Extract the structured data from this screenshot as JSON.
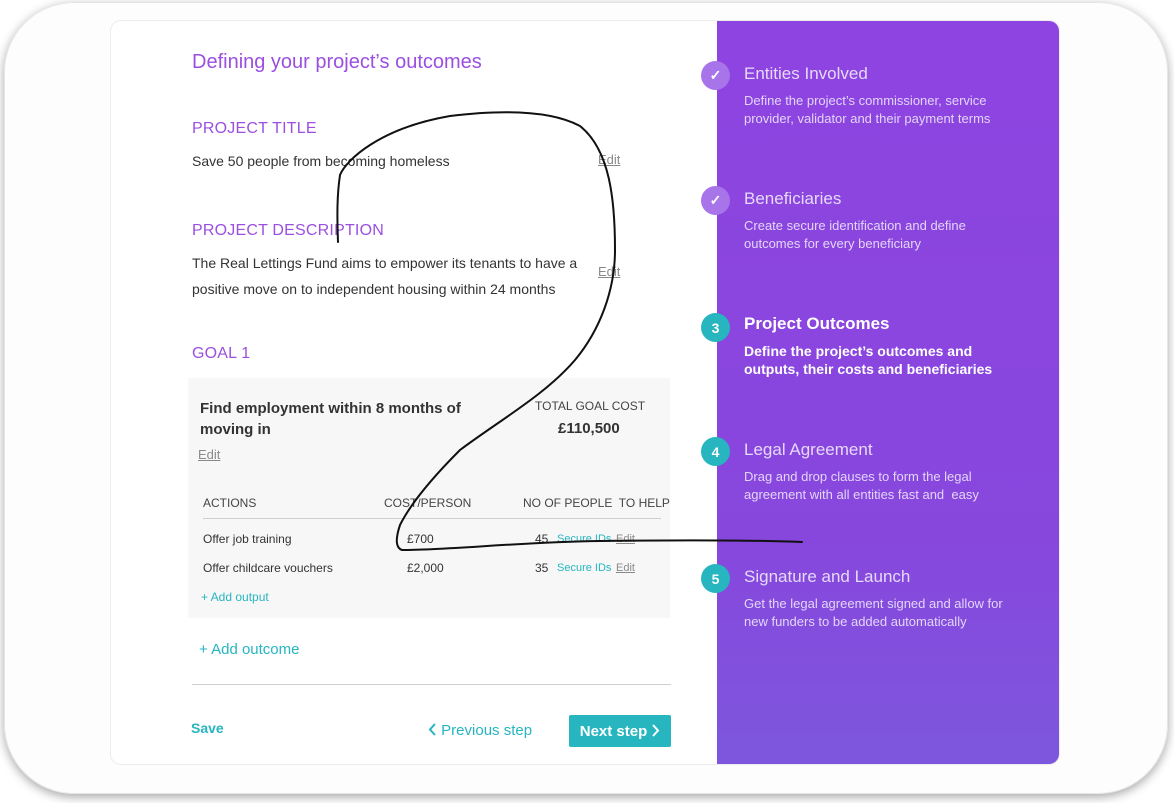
{
  "main": {
    "page_title": "Defining your project’s outcomes",
    "project_title": {
      "heading": "PROJECT TITLE",
      "value": "Save 50 people from becoming homeless",
      "edit_label": "Edit"
    },
    "project_description": {
      "heading": "PROJECT DESCRIPTION",
      "line1": "The Real Lettings Fund aims to empower its tenants to have a",
      "line2": "positive move on to independent housing within 24 months",
      "edit_label": "Edit"
    },
    "goal": {
      "heading": "GOAL 1",
      "title_line1": "Find employment within 8 months of",
      "title_line2": "moving in",
      "edit_label": "Edit",
      "total_cost_label": "TOTAL GOAL COST",
      "total_cost_value": "£110,500",
      "table": {
        "columns": [
          "ACTIONS",
          "COST/PERSON",
          "NO OF PEOPLE  TO HELP"
        ],
        "rows": [
          {
            "action": "Offer job training",
            "cost": "£700",
            "people": "45",
            "secure_label": "Secure IDs",
            "edit_label": "Edit"
          },
          {
            "action": "Offer childcare vouchers",
            "cost": "£2,000",
            "people": "35",
            "secure_label": "Secure IDs",
            "edit_label": "Edit"
          }
        ]
      },
      "add_output_label": "+ Add output"
    },
    "add_outcome_label": "+ Add outcome",
    "footer": {
      "save_label": "Save",
      "previous_label": "Previous step",
      "next_label": "Next step"
    }
  },
  "steps": [
    {
      "marker": "✓",
      "status": "done",
      "title": "Entities Involved",
      "desc_line1": "Define the project’s commissioner, service",
      "desc_line2": "provider, validator and their payment terms"
    },
    {
      "marker": "✓",
      "status": "done",
      "title": "Beneficiaries",
      "desc_line1": "Create secure identification and define",
      "desc_line2": "outcomes for every beneficiary"
    },
    {
      "marker": "3",
      "status": "current",
      "title": "Project Outcomes",
      "desc_line1": "Define the project’s outcomes and",
      "desc_line2": "outputs, their costs and beneficiaries"
    },
    {
      "marker": "4",
      "status": "upcoming",
      "title": "Legal Agreement",
      "desc_line1": "Drag and drop clauses to form the legal",
      "desc_line2": "agreement with all entities fast and  easy"
    },
    {
      "marker": "5",
      "status": "upcoming",
      "title": "Signature and Launch",
      "desc_line1": "Get the legal agreement signed and allow for",
      "desc_line2": "new funders to be added automatically"
    }
  ],
  "colors": {
    "accent_purple": "#9b4fe0",
    "sidebar_purple": "#8a45df",
    "teal": "#27b5c0"
  }
}
